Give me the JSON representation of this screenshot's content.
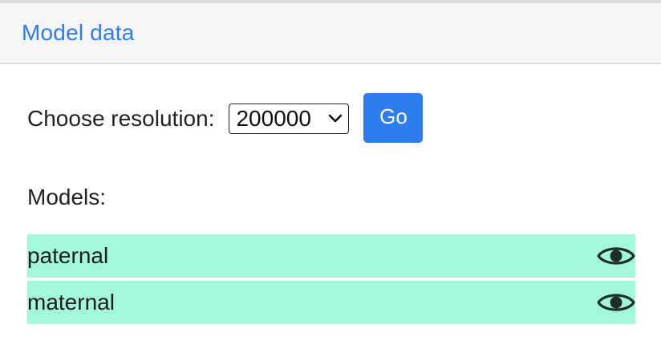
{
  "header": {
    "title": "Model data"
  },
  "resolution": {
    "label": "Choose resolution:",
    "selected": "200000",
    "go_label": "Go"
  },
  "models": {
    "label": "Models:",
    "items": [
      {
        "name": "paternal",
        "icon": "eye-icon"
      },
      {
        "name": "maternal",
        "icon": "eye-icon"
      }
    ]
  },
  "colors": {
    "accent": "#2f7cf0",
    "model_row_bg": "#a2f8d8",
    "header_bg": "#f5f5f5"
  }
}
